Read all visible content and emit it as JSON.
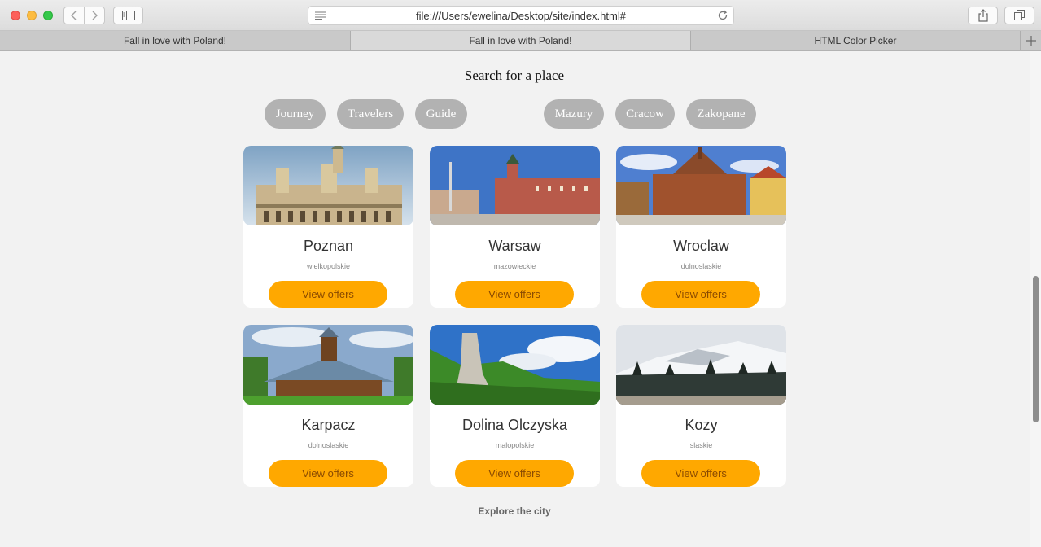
{
  "browser": {
    "url": "file:///Users/ewelina/Desktop/site/index.html#",
    "tabs": [
      {
        "label": "Fall in love with Poland!",
        "active": false
      },
      {
        "label": "Fall in love with Poland!",
        "active": true
      },
      {
        "label": "HTML Color Picker",
        "active": false
      }
    ]
  },
  "page": {
    "search_title": "Search for a place",
    "filters_left": [
      "Journey",
      "Travelers",
      "Guide"
    ],
    "filters_right": [
      "Mazury",
      "Cracow",
      "Zakopane"
    ],
    "cards": [
      {
        "city": "Poznan",
        "region": "wielkopolskie",
        "button": "View offers"
      },
      {
        "city": "Warsaw",
        "region": "mazowieckie",
        "button": "View offers"
      },
      {
        "city": "Wroclaw",
        "region": "dolnoslaskie",
        "button": "View offers"
      },
      {
        "city": "Karpacz",
        "region": "dolnoslaskie",
        "button": "View offers"
      },
      {
        "city": "Dolina Olczyska",
        "region": "malopolskie",
        "button": "View offers"
      },
      {
        "city": "Kozy",
        "region": "slaskie",
        "button": "View offers"
      }
    ],
    "explore": "Explore the city"
  },
  "colors": {
    "accent": "#ffa800",
    "pill": "#b2b2b2",
    "background": "#f2f2f2"
  }
}
